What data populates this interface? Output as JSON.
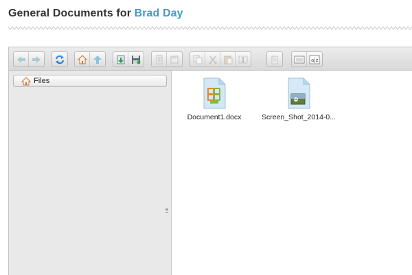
{
  "header": {
    "title_prefix": "General Documents for ",
    "user_name": "Brad Day"
  },
  "toolbar": {
    "buttons": [
      {
        "icon": "back-arrow-icon",
        "enabled": false
      },
      {
        "icon": "forward-arrow-icon",
        "enabled": false
      },
      {
        "icon": "reload-icon",
        "enabled": true
      },
      {
        "icon": "home-icon",
        "enabled": true
      },
      {
        "icon": "up-arrow-icon",
        "enabled": true
      },
      {
        "icon": "upload-icon",
        "enabled": true
      },
      {
        "icon": "save-disk-icon",
        "enabled": true
      },
      {
        "icon": "open-icon",
        "enabled": false
      },
      {
        "icon": "disk-icon",
        "enabled": false
      },
      {
        "icon": "copy-icon",
        "enabled": false
      },
      {
        "icon": "cut-icon",
        "enabled": false
      },
      {
        "icon": "paste-icon",
        "enabled": false
      },
      {
        "icon": "rename-icon",
        "enabled": false
      },
      {
        "icon": "delete-icon",
        "enabled": false
      },
      {
        "icon": "icons-view-icon",
        "enabled": true
      },
      {
        "icon": "list-view-icon",
        "enabled": true
      }
    ]
  },
  "sidebar": {
    "root_label": "Files",
    "root_icon": "home-icon"
  },
  "files": [
    {
      "name": "Document1.docx",
      "icon": "docx-file-icon"
    },
    {
      "name": "Screen_Shot_2014-0...",
      "icon": "image-file-icon"
    }
  ],
  "colors": {
    "accent": "#3aa0c4",
    "title": "#333333"
  }
}
